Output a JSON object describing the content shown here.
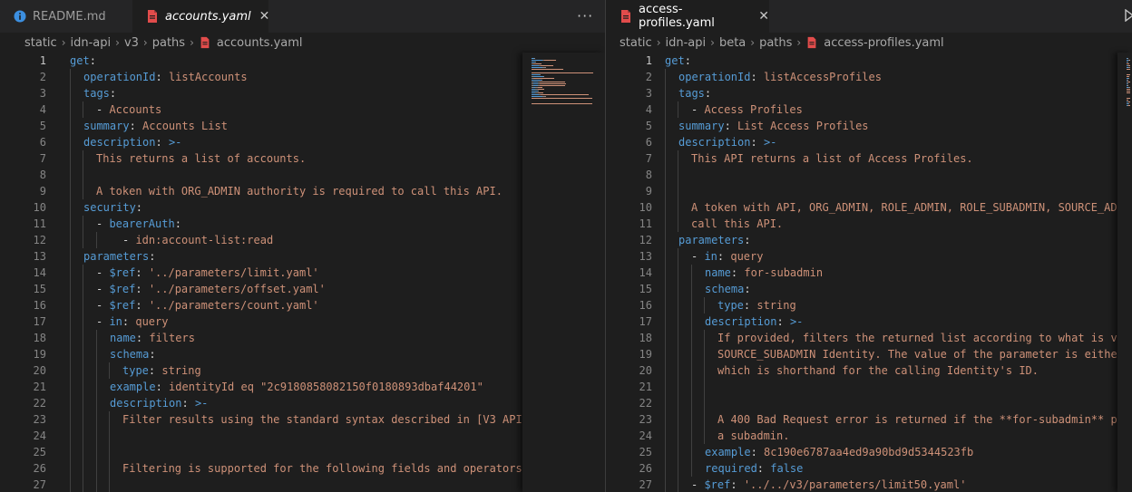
{
  "left_pane": {
    "tabs": [
      {
        "label": "README.md",
        "icon": "info-icon",
        "active": false
      },
      {
        "label": "accounts.yaml",
        "icon": "yaml-file-icon",
        "active": true,
        "close": "✕"
      }
    ],
    "more_actions": "···",
    "breadcrumb": [
      "static",
      "idn-api",
      "v3",
      "paths",
      "accounts.yaml"
    ],
    "current_line": 1,
    "lines": [
      [
        {
          "t": "k",
          "v": "get"
        },
        {
          "t": "o",
          "v": ":"
        }
      ],
      [
        {
          "t": "k",
          "v": "operationId"
        },
        {
          "t": "o",
          "v": ": "
        },
        {
          "t": "s",
          "v": "listAccounts"
        }
      ],
      [
        {
          "t": "k",
          "v": "tags"
        },
        {
          "t": "o",
          "v": ":"
        }
      ],
      [
        {
          "t": "o",
          "v": "- "
        },
        {
          "t": "s",
          "v": "Accounts"
        }
      ],
      [
        {
          "t": "k",
          "v": "summary"
        },
        {
          "t": "o",
          "v": ": "
        },
        {
          "t": "s",
          "v": "Accounts List"
        }
      ],
      [
        {
          "t": "k",
          "v": "description"
        },
        {
          "t": "o",
          "v": ": "
        },
        {
          "t": "b",
          "v": ">-"
        }
      ],
      [
        {
          "t": "s",
          "v": "This returns a list of accounts."
        }
      ],
      [],
      [
        {
          "t": "s",
          "v": "A token with ORG_ADMIN authority is required to call this API."
        }
      ],
      [
        {
          "t": "k",
          "v": "security"
        },
        {
          "t": "o",
          "v": ":"
        }
      ],
      [
        {
          "t": "o",
          "v": "- "
        },
        {
          "t": "k",
          "v": "bearerAuth"
        },
        {
          "t": "o",
          "v": ":"
        }
      ],
      [
        {
          "t": "o",
          "v": "- "
        },
        {
          "t": "s",
          "v": "idn:account-list:read"
        }
      ],
      [
        {
          "t": "k",
          "v": "parameters"
        },
        {
          "t": "o",
          "v": ":"
        }
      ],
      [
        {
          "t": "o",
          "v": "- "
        },
        {
          "t": "k",
          "v": "$ref"
        },
        {
          "t": "o",
          "v": ": "
        },
        {
          "t": "s",
          "v": "'../parameters/limit.yaml'"
        }
      ],
      [
        {
          "t": "o",
          "v": "- "
        },
        {
          "t": "k",
          "v": "$ref"
        },
        {
          "t": "o",
          "v": ": "
        },
        {
          "t": "s",
          "v": "'../parameters/offset.yaml'"
        }
      ],
      [
        {
          "t": "o",
          "v": "- "
        },
        {
          "t": "k",
          "v": "$ref"
        },
        {
          "t": "o",
          "v": ": "
        },
        {
          "t": "s",
          "v": "'../parameters/count.yaml'"
        }
      ],
      [
        {
          "t": "o",
          "v": "- "
        },
        {
          "t": "k",
          "v": "in"
        },
        {
          "t": "o",
          "v": ": "
        },
        {
          "t": "s",
          "v": "query"
        }
      ],
      [
        {
          "t": "k",
          "v": "name"
        },
        {
          "t": "o",
          "v": ": "
        },
        {
          "t": "s",
          "v": "filters"
        }
      ],
      [
        {
          "t": "k",
          "v": "schema"
        },
        {
          "t": "o",
          "v": ":"
        }
      ],
      [
        {
          "t": "k",
          "v": "type"
        },
        {
          "t": "o",
          "v": ": "
        },
        {
          "t": "s",
          "v": "string"
        }
      ],
      [
        {
          "t": "k",
          "v": "example"
        },
        {
          "t": "o",
          "v": ": "
        },
        {
          "t": "s",
          "v": "identityId eq \"2c9180858082150f0180893dbaf44201\""
        }
      ],
      [
        {
          "t": "k",
          "v": "description"
        },
        {
          "t": "o",
          "v": ": "
        },
        {
          "t": "b",
          "v": ">-"
        }
      ],
      [
        {
          "t": "s",
          "v": "Filter results using the standard syntax described in [V3 API"
        }
      ],
      [],
      [],
      [
        {
          "t": "s",
          "v": "Filtering is supported for the following fields and operators"
        }
      ],
      []
    ]
  },
  "right_pane": {
    "tabs": [
      {
        "label": "access-profiles.yaml",
        "icon": "yaml-file-icon",
        "active": true,
        "close": "✕"
      }
    ],
    "breadcrumb": [
      "static",
      "idn-api",
      "beta",
      "paths",
      "access-profiles.yaml"
    ],
    "current_line": 1,
    "lines": [
      [
        {
          "t": "k",
          "v": "get"
        },
        {
          "t": "o",
          "v": ":"
        }
      ],
      [
        {
          "t": "k",
          "v": "operationId"
        },
        {
          "t": "o",
          "v": ": "
        },
        {
          "t": "s",
          "v": "listAccessProfiles"
        }
      ],
      [
        {
          "t": "k",
          "v": "tags"
        },
        {
          "t": "o",
          "v": ":"
        }
      ],
      [
        {
          "t": "o",
          "v": "- "
        },
        {
          "t": "s",
          "v": "Access Profiles"
        }
      ],
      [
        {
          "t": "k",
          "v": "summary"
        },
        {
          "t": "o",
          "v": ": "
        },
        {
          "t": "s",
          "v": "List Access Profiles"
        }
      ],
      [
        {
          "t": "k",
          "v": "description"
        },
        {
          "t": "o",
          "v": ": "
        },
        {
          "t": "b",
          "v": ">-"
        }
      ],
      [
        {
          "t": "s",
          "v": "This API returns a list of Access Profiles."
        }
      ],
      [],
      [],
      [
        {
          "t": "s",
          "v": "A token with API, ORG_ADMIN, ROLE_ADMIN, ROLE_SUBADMIN, SOURCE_AD"
        }
      ],
      [
        {
          "t": "s",
          "v": "call this API."
        }
      ],
      [
        {
          "t": "k",
          "v": "parameters"
        },
        {
          "t": "o",
          "v": ":"
        }
      ],
      [
        {
          "t": "o",
          "v": "- "
        },
        {
          "t": "k",
          "v": "in"
        },
        {
          "t": "o",
          "v": ": "
        },
        {
          "t": "s",
          "v": "query"
        }
      ],
      [
        {
          "t": "k",
          "v": "name"
        },
        {
          "t": "o",
          "v": ": "
        },
        {
          "t": "s",
          "v": "for-subadmin"
        }
      ],
      [
        {
          "t": "k",
          "v": "schema"
        },
        {
          "t": "o",
          "v": ":"
        }
      ],
      [
        {
          "t": "k",
          "v": "type"
        },
        {
          "t": "o",
          "v": ": "
        },
        {
          "t": "s",
          "v": "string"
        }
      ],
      [
        {
          "t": "k",
          "v": "description"
        },
        {
          "t": "o",
          "v": ": "
        },
        {
          "t": "b",
          "v": ">-"
        }
      ],
      [
        {
          "t": "s",
          "v": "If provided, filters the returned list according to what is v"
        }
      ],
      [
        {
          "t": "s",
          "v": "SOURCE_SUBADMIN Identity. The value of the parameter is eithe"
        }
      ],
      [
        {
          "t": "s",
          "v": "which is shorthand for the calling Identity's ID."
        }
      ],
      [],
      [],
      [
        {
          "t": "s",
          "v": "A 400 Bad Request error is returned if the **for-subadmin** p"
        }
      ],
      [
        {
          "t": "s",
          "v": "a subadmin."
        }
      ],
      [
        {
          "t": "k",
          "v": "example"
        },
        {
          "t": "o",
          "v": ": "
        },
        {
          "t": "s",
          "v": "8c190e6787aa4ed9a90bd9d5344523fb"
        }
      ],
      [
        {
          "t": "k",
          "v": "required"
        },
        {
          "t": "o",
          "v": ": "
        },
        {
          "t": "b",
          "v": "false"
        }
      ],
      [
        {
          "t": "o",
          "v": "- "
        },
        {
          "t": "k",
          "v": "$ref"
        },
        {
          "t": "o",
          "v": ": "
        },
        {
          "t": "s",
          "v": "'../../v3/parameters/limit50.yaml'"
        }
      ]
    ]
  },
  "colors": {
    "editor_bg": "#1e1e1e",
    "tabbar_bg": "#252526",
    "key": "#569cd6",
    "string": "#ce9178",
    "yaml_icon": "#e24c4b",
    "info_icon": "#3c8fe0"
  }
}
